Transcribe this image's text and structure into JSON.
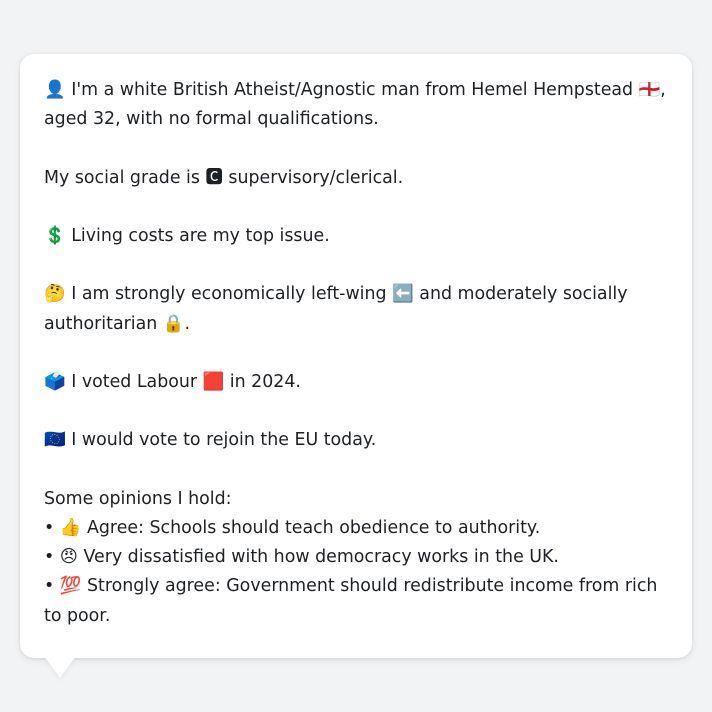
{
  "message": {
    "intro": {
      "icon": "👤",
      "text_before_flag": "I'm a white British Atheist/Agnostic man from Hemel Hempstead",
      "flag": "🏴󠁧󠁢󠁥󠁮󠁧󠁿",
      "text_after_flag": ", aged 32, with no formal qualifications."
    },
    "social_grade": {
      "text_before": "My social grade is",
      "badge": "🅲",
      "text_after": "supervisory/clerical."
    },
    "top_issue": {
      "icon": "💲",
      "text": "Living costs are my top issue."
    },
    "politics": {
      "icon": "🤔",
      "text_before": "I am strongly economically left-wing",
      "left_icon": "⬅️",
      "text_middle": "and moderately socially authoritarian",
      "lock_icon": "🔒",
      "text_after": "."
    },
    "vote_2024": {
      "icon": "🗳️",
      "text_before": "I voted Labour",
      "party_icon": "🟥",
      "text_after": "in 2024."
    },
    "eu": {
      "icon": "🇪🇺",
      "text": "I would vote to rejoin the EU today."
    },
    "opinions": {
      "heading": "Some opinions I hold:",
      "bullet": "•",
      "items": [
        {
          "icon": "👍",
          "text": "Agree: Schools should teach obedience to authority."
        },
        {
          "icon": "😠",
          "text": "Very dissatisfied with how democracy works in the UK."
        },
        {
          "icon": "💯",
          "text": "Strongly agree: Government should redistribute income from rich to poor."
        }
      ]
    }
  }
}
